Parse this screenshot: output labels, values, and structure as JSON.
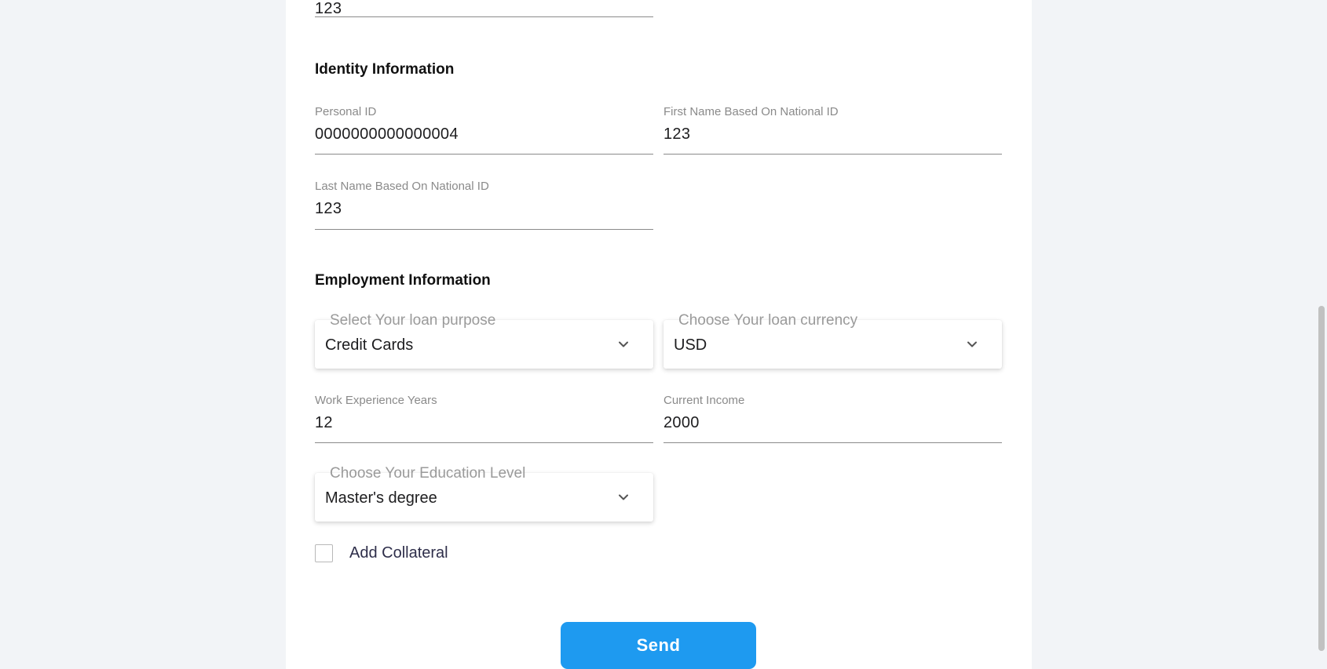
{
  "top_field": {
    "value": "123"
  },
  "identity": {
    "title": "Identity Information",
    "personal_id": {
      "label": "Personal ID",
      "value": "0000000000000004"
    },
    "first_name": {
      "label": "First Name Based On National ID",
      "value": "123"
    },
    "last_name": {
      "label": "Last Name Based On National ID",
      "value": "123"
    }
  },
  "employment": {
    "title": "Employment Information",
    "loan_purpose": {
      "label": "Select Your loan purpose",
      "value": "Credit Cards",
      "icon": "chevron-down-icon"
    },
    "loan_currency": {
      "label": "Choose Your loan currency",
      "value": "USD",
      "icon": "chevron-down-icon"
    },
    "work_experience": {
      "label": "Work Experience Years",
      "value": "12"
    },
    "current_income": {
      "label": "Current Income",
      "value": "2000"
    },
    "education": {
      "label": "Choose Your Education Level",
      "value": "Master's degree",
      "icon": "chevron-down-icon"
    }
  },
  "collateral": {
    "label": "Add Collateral",
    "checked": false
  },
  "send_button": {
    "label": "Send"
  },
  "colors": {
    "accent": "#1e9af0",
    "page_bg": "#f2f4f7",
    "card_bg": "#ffffff"
  }
}
